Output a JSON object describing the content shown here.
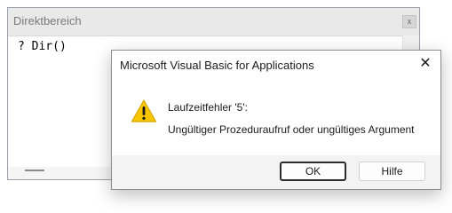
{
  "immediate_window": {
    "title": "Direktbereich",
    "close_label": "x",
    "code": "? Dir()"
  },
  "dialog": {
    "title": "Microsoft Visual Basic for Applications",
    "close_label": "✕",
    "icon": "warning-icon",
    "error_title": "Laufzeitfehler '5':",
    "error_message": "Ungültiger Prozeduraufruf oder ungültiges Argument",
    "ok_label": "OK",
    "help_label": "Hilfe"
  },
  "colors": {
    "warning_fill": "#f7c600",
    "warning_mark": "#1a1a1a"
  }
}
